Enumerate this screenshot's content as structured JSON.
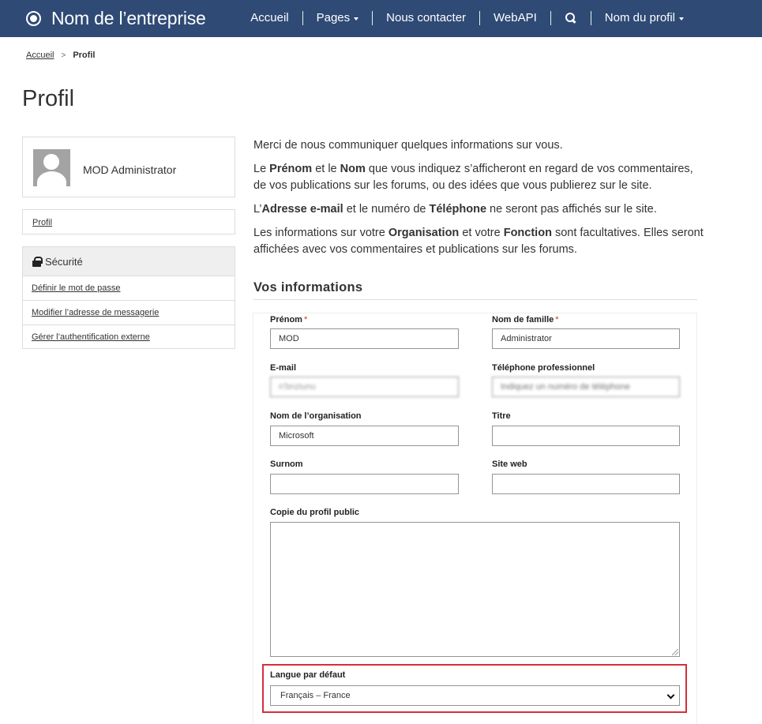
{
  "navbar": {
    "brand": "Nom de l’entreprise",
    "items": {
      "home": "Accueil",
      "pages": "Pages",
      "contact": "Nous contacter",
      "webapi": "WebAPI",
      "profile": "Nom du profil"
    }
  },
  "breadcrumb": {
    "home": "Accueil",
    "separator": ">",
    "current": "Profil"
  },
  "page_title": "Profil",
  "sidebar": {
    "user_name": "MOD Administrator",
    "profile_link": "Profil",
    "security": {
      "header": "Sécurité",
      "links": [
        "Définir le mot de passe",
        "Modifier l’adresse de messagerie",
        "Gérer l’authentification externe"
      ]
    }
  },
  "intro": {
    "p1": "Merci de nous communiquer quelques informations sur vous.",
    "p2": {
      "a": "Le ",
      "b1": "Prénom",
      "c": " et le ",
      "b2": "Nom",
      "d": " que vous indiquez s’afficheront en regard de vos commentaires, de vos publications sur les forums, ou des idées que vous publierez sur le site."
    },
    "p3": {
      "a": "L’",
      "b1": "Adresse e-mail",
      "c": " et le numéro de ",
      "b2": "Téléphone",
      "d": " ne seront pas affichés sur le site."
    },
    "p4": {
      "a": "Les informations sur votre ",
      "b1": "Organisation",
      "c": " et votre ",
      "b2": "Fonction",
      "d": " sont facultatives. Elles seront affichées avec vos commentaires et publications sur les forums."
    }
  },
  "section_title": "Vos informations",
  "form": {
    "required_mark": "*",
    "first_name": {
      "label": "Prénom",
      "value": "MOD"
    },
    "last_name": {
      "label": "Nom de famille",
      "value": "Administrator"
    },
    "email": {
      "label": "E-mail",
      "value": "n'bnziunu"
    },
    "phone": {
      "label": "Téléphone professionnel",
      "placeholder": "Indiquez un numéro de téléphone"
    },
    "organization": {
      "label": "Nom de l’organisation",
      "value": "Microsoft"
    },
    "title": {
      "label": "Titre",
      "value": ""
    },
    "nickname": {
      "label": "Surnom",
      "value": ""
    },
    "website": {
      "label": "Site web",
      "value": ""
    },
    "public_profile": {
      "label": "Copie du profil public",
      "value": ""
    },
    "language": {
      "label": "Langue par défaut",
      "value": "Français – France"
    }
  },
  "colors": {
    "navbar": "#2f4a75",
    "highlight_border": "#d32f3c",
    "required": "#c0392b"
  }
}
